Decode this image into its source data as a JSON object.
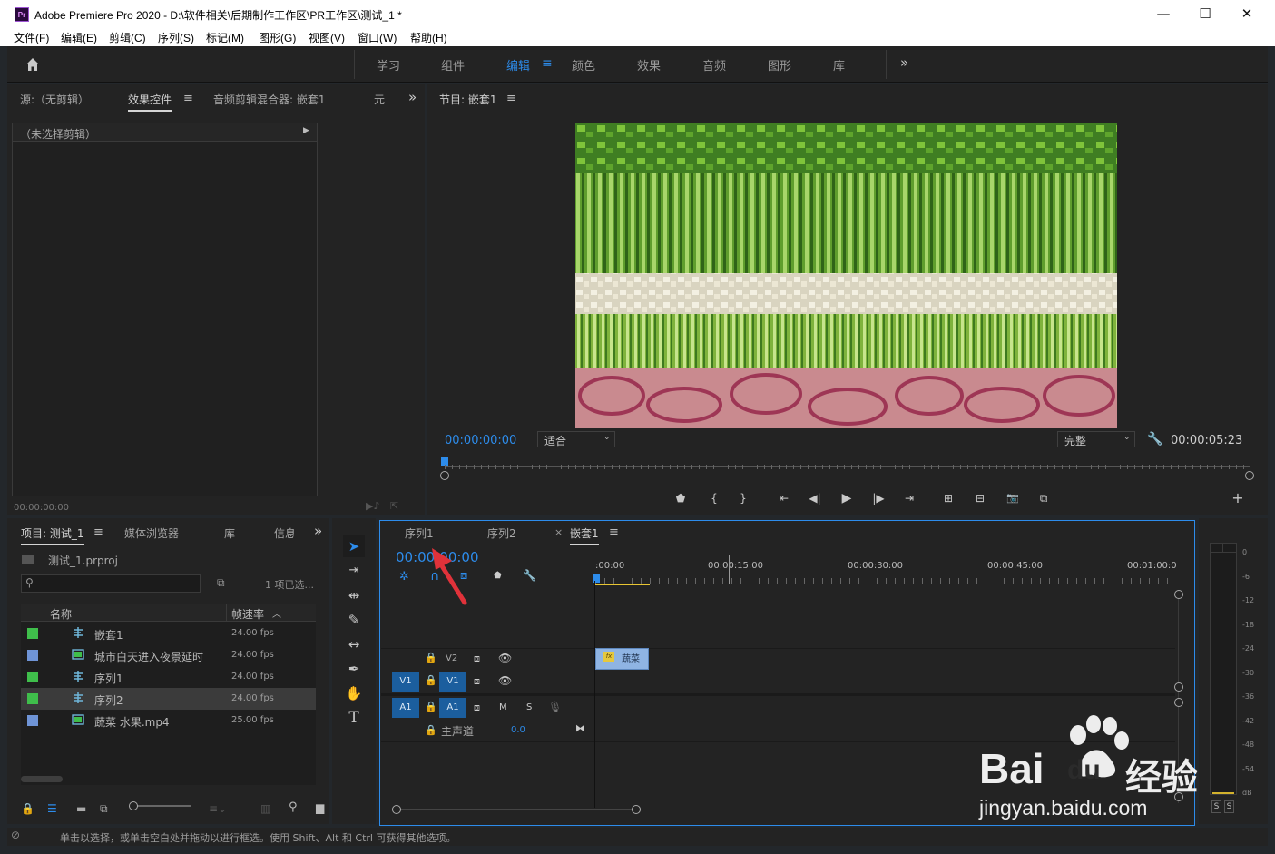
{
  "window": {
    "app_icon": "Pr",
    "title": "Adobe Premiere Pro 2020 - D:\\软件相关\\后期制作工作区\\PR工作区\\测试_1 *",
    "minimize": "—",
    "maximize": "☐",
    "close": "✕"
  },
  "menu": [
    "文件(F)",
    "编辑(E)",
    "剪辑(C)",
    "序列(S)",
    "标记(M)",
    "图形(G)",
    "视图(V)",
    "窗口(W)",
    "帮助(H)"
  ],
  "workspaces": {
    "tabs": [
      "学习",
      "组件",
      "编辑",
      "颜色",
      "效果",
      "音频",
      "图形",
      "库"
    ],
    "active": "编辑",
    "more": "»"
  },
  "source_panel": {
    "tabs": [
      "源:（无剪辑）",
      "效果控件",
      "音频剪辑混合器: 嵌套1",
      "元"
    ],
    "active_tab": "效果控件",
    "no_clip": "（未选择剪辑）",
    "timecode": "00:00:00:00",
    "more": "»"
  },
  "program_monitor": {
    "title": "节目: 嵌套1",
    "timecode_current": "00:00:00:00",
    "fit": "适合",
    "quality": "完整",
    "timecode_duration": "00:00:05:23",
    "controls": {
      "add_marker": "⬟",
      "mark_in": "{",
      "mark_out": "}",
      "go_in": "⇤",
      "step_back": "◀|",
      "play": "▶",
      "step_forward": "|▶",
      "go_out": "⇥",
      "lift": "⊞",
      "extract": "⊟",
      "export_frame": "📷",
      "compare": "⧉",
      "add": "+"
    }
  },
  "project_panel": {
    "tabs": [
      "项目: 测试_1",
      "媒体浏览器",
      "库",
      "信息"
    ],
    "active_tab": "项目: 测试_1",
    "file": "测试_1.prproj",
    "search_placeholder": "",
    "selected_count": "1 项已选...",
    "columns": {
      "name": "名称",
      "frame_rate": "帧速率"
    },
    "items": [
      {
        "name": "嵌套1",
        "fps": "24.00 fps",
        "color": "#3fbe4b",
        "type": "sequence"
      },
      {
        "name": "城市白天进入夜景延时",
        "fps": "24.00 fps",
        "color": "#6f94d6",
        "type": "clip"
      },
      {
        "name": "序列1",
        "fps": "24.00 fps",
        "color": "#3fbe4b",
        "type": "sequence"
      },
      {
        "name": "序列2",
        "fps": "24.00 fps",
        "color": "#3fbe4b",
        "type": "sequence"
      },
      {
        "name": "蔬菜 水果.mp4",
        "fps": "25.00 fps",
        "color": "#6f94d6",
        "type": "clip"
      }
    ],
    "selected_index": 3
  },
  "timeline": {
    "tabs": [
      "序列1",
      "序列2",
      "嵌套1"
    ],
    "active_tab": "嵌套1",
    "close_glyph": "×",
    "timecode": "00:00:00:00",
    "ruler": [
      ":00:00",
      "00:00:15:00",
      "00:00:30:00",
      "00:00:45:00",
      "00:01:00:0"
    ],
    "tracks": {
      "v2": "V2",
      "v1_source": "V1",
      "v1": "V1",
      "a1_source": "A1",
      "a1": "A1",
      "mute": "M",
      "solo": "S",
      "master": "主声道",
      "master_value": "0.0"
    },
    "clip": {
      "fx": "fx",
      "name": "蔬菜"
    }
  },
  "audio_meter": {
    "ticks": [
      "0",
      "-6",
      "-12",
      "-18",
      "-24",
      "-30",
      "-36",
      "-42",
      "-48",
      "-54",
      "dB"
    ],
    "solo_left": "S",
    "solo_right": "S"
  },
  "status_bar": "单击以选择，或单击空白处并拖动以进行框选。使用 Shift、Alt 和 Ctrl 可获得其他选项。",
  "watermark": {
    "brand": "Bai",
    "brand2": "du",
    "cn": "经验",
    "url": "jingyan.baidu.com"
  },
  "colors": {
    "accent": "#2d8ceb",
    "track_blue": "#1b5e9e",
    "clip": "#8fb4e3",
    "playhead": "#2d8ceb",
    "arrow": "#e0323a"
  }
}
